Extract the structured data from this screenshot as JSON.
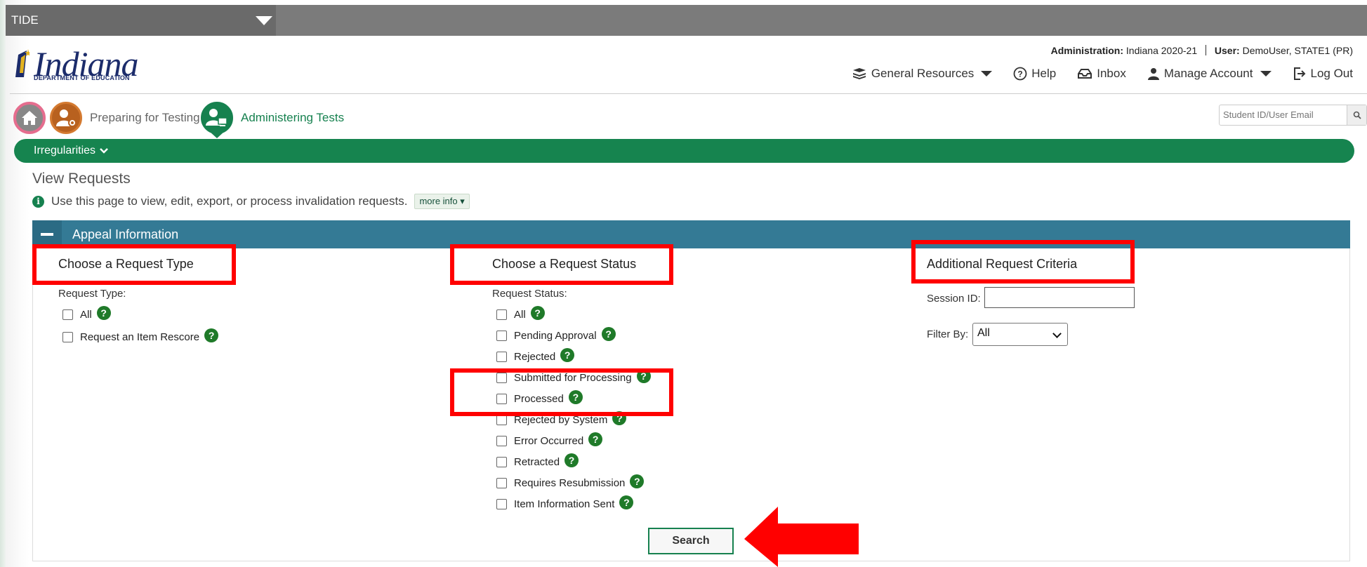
{
  "tide": {
    "label": "TIDE"
  },
  "logo": {
    "word": "Indiana",
    "sub": "DEPARTMENT OF EDUCATION"
  },
  "header": {
    "admin_label": "Administration:",
    "admin_value": "Indiana 2020-21",
    "user_label": "User:",
    "user_value": "DemoUser, STATE1 (PR)",
    "nav": {
      "resources": "General Resources",
      "help": "Help",
      "inbox": "Inbox",
      "account": "Manage Account",
      "logout": "Log Out"
    }
  },
  "breadcrumb": {
    "preparing": "Preparing for Testing",
    "administering": "Administering Tests"
  },
  "search": {
    "placeholder": "Student ID/User Email"
  },
  "greennav": {
    "label": "Irregularities"
  },
  "page": {
    "title": "View Requests",
    "info": "Use this page to view, edit, export, or process invalidation requests.",
    "more_info": "more info"
  },
  "panel": {
    "title": "Appeal Information"
  },
  "request_type": {
    "heading": "Choose a Request Type",
    "label": "Request Type:",
    "options": [
      "All",
      "Request an Item Rescore"
    ]
  },
  "request_status": {
    "heading": "Choose a Request Status",
    "label": "Request Status:",
    "options": [
      "All",
      "Pending Approval",
      "Rejected",
      "Submitted for Processing",
      "Processed",
      "Rejected by System",
      "Error Occurred",
      "Retracted",
      "Requires Resubmission",
      "Item Information Sent"
    ]
  },
  "additional": {
    "heading": "Additional Request Criteria",
    "session_label": "Session ID:",
    "session_value": "",
    "filter_label": "Filter By:",
    "filter_value": "All"
  },
  "actions": {
    "search": "Search"
  },
  "colors": {
    "green": "#16844f",
    "teal": "#347a95",
    "highlight": "#ff0000"
  }
}
